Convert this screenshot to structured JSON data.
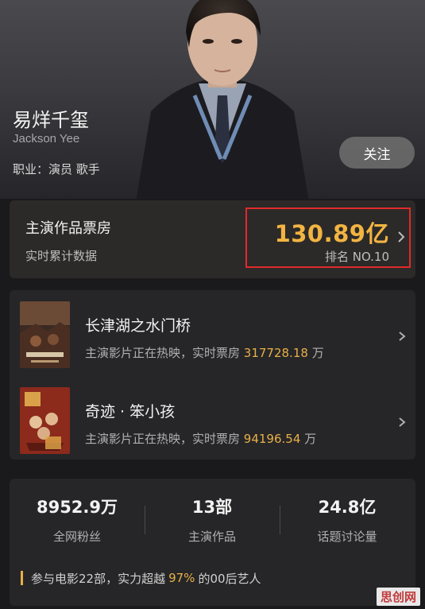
{
  "artist": {
    "name_cn": "易烊千玺",
    "name_en": "Jackson Yee",
    "job": "职业：演员 歌手",
    "follow_label": "关注"
  },
  "box_office": {
    "title": "主演作品票房",
    "subtitle": "实时累计数据",
    "amount": "130.89亿",
    "rank": "排名 NO.10"
  },
  "movies": [
    {
      "title": "长津湖之水门桥",
      "desc_prefix": "主演影片正在热映，实时票房",
      "box_value": "317728.18",
      "unit": "万"
    },
    {
      "title": "奇迹 · 笨小孩",
      "desc_prefix": "主演影片正在热映，实时票房",
      "box_value": "94196.54",
      "unit": "万"
    }
  ],
  "stats": [
    {
      "value": "8952.9万",
      "label": "全网粉丝"
    },
    {
      "value": "13部",
      "label": "主演作品"
    },
    {
      "value": "24.8亿",
      "label": "话题讨论量"
    }
  ],
  "note": {
    "prefix": "参与电影22部，实力超越",
    "percent": "97%",
    "suffix": "的00后艺人"
  },
  "watermark": "思创网",
  "colors": {
    "accent_gold": "#f2b442",
    "highlight_red": "#e02a2a",
    "background": "#1a1a1c"
  }
}
